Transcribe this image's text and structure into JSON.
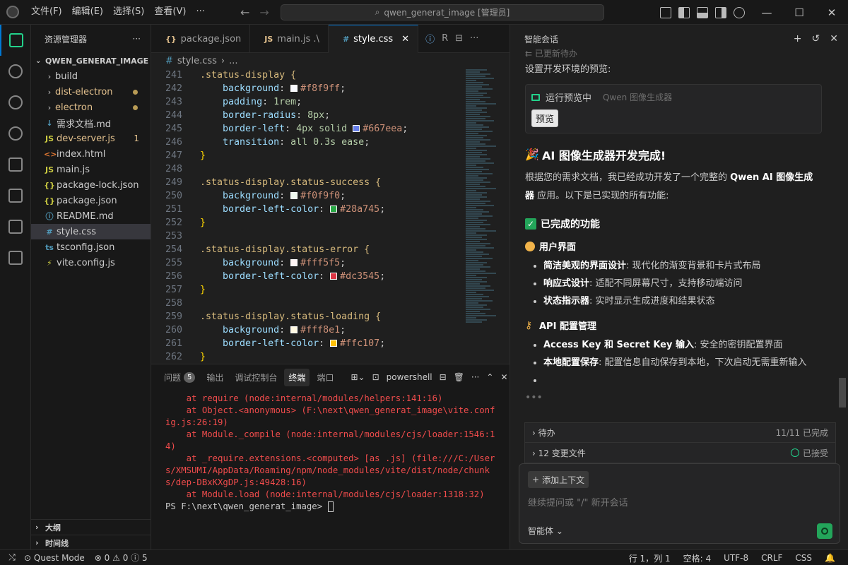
{
  "menu": [
    "文件(F)",
    "编辑(E)",
    "选择(S)",
    "查看(V)",
    "···"
  ],
  "search": {
    "text": "qwen_generat_image [管理员]"
  },
  "sidebar": {
    "title": "资源管理器",
    "root": "QWEN_GENERAT_IMAGE",
    "items": [
      {
        "label": "build",
        "icon": "›",
        "type": "folder"
      },
      {
        "label": "dist-electron",
        "icon": "›",
        "type": "folder",
        "modified": true
      },
      {
        "label": "electron",
        "icon": "›",
        "type": "folder",
        "modified": true
      },
      {
        "label": "需求文档.md",
        "icon": "↓",
        "type": "md"
      },
      {
        "label": "dev-server.js",
        "icon": "JS",
        "type": "js",
        "badge": "1"
      },
      {
        "label": "index.html",
        "icon": "<>",
        "type": "html"
      },
      {
        "label": "main.js",
        "icon": "JS",
        "type": "js"
      },
      {
        "label": "package-lock.json",
        "icon": "{}",
        "type": "json"
      },
      {
        "label": "package.json",
        "icon": "{}",
        "type": "json"
      },
      {
        "label": "README.md",
        "icon": "ⓘ",
        "type": "info"
      },
      {
        "label": "style.css",
        "icon": "#",
        "type": "css",
        "selected": true
      },
      {
        "label": "tsconfig.json",
        "icon": "ts",
        "type": "ts"
      },
      {
        "label": "vite.config.js",
        "icon": "⚡",
        "type": "vite"
      }
    ],
    "outline": "大纲",
    "timeline": "时间线"
  },
  "tabs": [
    {
      "label": "package.json",
      "icon": "{}"
    },
    {
      "label": "main.js .\\",
      "icon": "JS"
    },
    {
      "label": "style.css",
      "icon": "#",
      "active": true
    }
  ],
  "tab_extra": "R",
  "breadcrumb": {
    "file": "style.css",
    "rest": "..."
  },
  "code_lines": [
    {
      "n": "241",
      "kind": "sel",
      "text": ".status-display {"
    },
    {
      "n": "242",
      "kind": "prop",
      "prop": "background",
      "color": "#f8f9ff",
      "value": "#f8f9ff"
    },
    {
      "n": "243",
      "kind": "prop",
      "prop": "padding",
      "value": "1rem"
    },
    {
      "n": "244",
      "kind": "prop",
      "prop": "border-radius",
      "value": "8px"
    },
    {
      "n": "245",
      "kind": "prop",
      "prop": "border-left",
      "value": "4px solid",
      "color": "#667eea",
      "value2": "#667eea"
    },
    {
      "n": "246",
      "kind": "prop",
      "prop": "transition",
      "value": "all 0.3s ease"
    },
    {
      "n": "247",
      "kind": "close",
      "text": "}"
    },
    {
      "n": "248",
      "kind": "blank",
      "text": ""
    },
    {
      "n": "249",
      "kind": "sel",
      "text": ".status-display.status-success {"
    },
    {
      "n": "250",
      "kind": "prop",
      "prop": "background",
      "color": "#f0f9f0",
      "value": "#f0f9f0"
    },
    {
      "n": "251",
      "kind": "prop",
      "prop": "border-left-color",
      "color": "#28a745",
      "value": "#28a745"
    },
    {
      "n": "252",
      "kind": "close",
      "text": "}"
    },
    {
      "n": "253",
      "kind": "blank",
      "text": ""
    },
    {
      "n": "254",
      "kind": "sel",
      "text": ".status-display.status-error {"
    },
    {
      "n": "255",
      "kind": "prop",
      "prop": "background",
      "color": "#fff5f5",
      "value": "#fff5f5"
    },
    {
      "n": "256",
      "kind": "prop",
      "prop": "border-left-color",
      "color": "#dc3545",
      "value": "#dc3545"
    },
    {
      "n": "257",
      "kind": "close",
      "text": "}"
    },
    {
      "n": "258",
      "kind": "blank",
      "text": ""
    },
    {
      "n": "259",
      "kind": "sel",
      "text": ".status-display.status-loading {"
    },
    {
      "n": "260",
      "kind": "prop",
      "prop": "background",
      "color": "#fff8e1",
      "value": "#fff8e1"
    },
    {
      "n": "261",
      "kind": "prop",
      "prop": "border-left-color",
      "color": "#ffc107",
      "value": "#ffc107"
    },
    {
      "n": "262",
      "kind": "close",
      "text": "}"
    }
  ],
  "panel": {
    "tabs": [
      "问题",
      "输出",
      "调试控制台",
      "终端",
      "端口"
    ],
    "problems_count": "5",
    "active_tab": "终端",
    "shell": "powershell"
  },
  "terminal_lines": [
    "    at require (node:internal/modules/helpers:141:16)",
    "    at Object.<anonymous> (F:\\next\\qwen_generat_image\\vite.config.js:26:19)",
    "    at Module._compile (node:internal/modules/cjs/loader:1546:14)",
    "    at _require.extensions.<computed> [as .js] (file:///C:/Users/XMSUMI/AppData/Roaming/npm/node_modules/vite/dist/node/chunks/dep-DBxKXgDP.js:49428:16)",
    "    at Module.load (node:internal/modules/cjs/loader:1318:32)"
  ],
  "terminal_prompt": "PS F:\\next\\qwen_generat_image> ",
  "chat": {
    "title": "智能会话",
    "faded_line": "已更新待办",
    "setup_text": "设置开发环境的预览:",
    "preview_label": "运行预览中",
    "preview_sub": "Qwen 图像生成器",
    "preview_button": "预览",
    "heading": "AI 图像生成器开发完成!",
    "intro_pre": "根据您的需求文档，我已经成功开发了一个完整的 ",
    "intro_bold": "Qwen AI 图像生成器",
    "intro_post": " 应用。以下是已实现的所有功能:",
    "done_heading": "已完成的功能",
    "ui_heading": "用户界面",
    "ui_items": [
      {
        "bold": "简洁美观的界面设计",
        "text": ": 现代化的渐变背景和卡片式布局"
      },
      {
        "bold": "响应式设计",
        "text": ": 适配不同屏幕尺寸，支持移动端访问"
      },
      {
        "bold": "状态指示器",
        "text": ": 实时显示生成进度和结果状态"
      }
    ],
    "api_heading": "API 配置管理",
    "api_items": [
      {
        "bold": "Access Key 和 Secret Key 输入",
        "text": ": 安全的密钥配置界面"
      },
      {
        "bold": "本地配置保存",
        "text": ": 配置信息自动保存到本地，下次启动无需重新输入"
      },
      {
        "bold": "",
        "text": ""
      }
    ],
    "ellipsis": "•••",
    "todo_label": "待办",
    "todo_status": "11/11 已完成",
    "changes_label": "12 变更文件",
    "changes_status": "已接受",
    "add_context": "添加上下文",
    "input_placeholder": "继续提问或 \"/\" 新开会话",
    "agent_label": "智能体"
  },
  "statusbar": {
    "mode": "Quest Mode",
    "errors": "0",
    "warnings": "0",
    "info": "5",
    "position": "行 1，列 1",
    "spaces": "空格: 4",
    "encoding": "UTF-8",
    "eol": "CRLF",
    "language": "CSS"
  }
}
